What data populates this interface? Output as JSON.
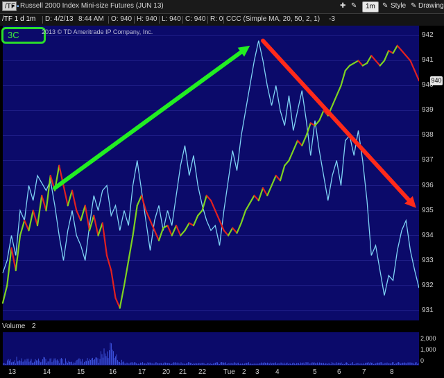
{
  "toolbar": {
    "symbol": "/TF",
    "title": "Russell 2000 Index Mini-size Futures (JUN 13)",
    "timeframe": "1m",
    "style_label": "Style",
    "drawings_label": "Drawings"
  },
  "infobar": {
    "symbol_tf": "/TF 1 d 1m",
    "date": "D: 4/2/13",
    "time": "8:44 AM",
    "open": "O: 940",
    "high": "H: 940",
    "low": "L: 940",
    "close": "C: 940",
    "r": "R: 0",
    "study": "CCC (Simple MA, 20, 50, 2, 1)",
    "study_value": "-3"
  },
  "badge": "3C",
  "copyright": "2013 © TD Ameritrade IP Company, Inc.",
  "volume_label": "Volume",
  "volume_value": "2",
  "last_price": "940",
  "chart_data": {
    "type": "line",
    "x_ticks": [
      "13",
      "14",
      "15",
      "16",
      "17",
      "20",
      "21",
      "22",
      "Tue",
      "2",
      "3",
      "4",
      "5",
      "6",
      "7",
      "8"
    ],
    "y_ticks": [
      942,
      941,
      940,
      939,
      938,
      937,
      936,
      935,
      934,
      933,
      932,
      931
    ],
    "ylim": [
      930.6,
      942.4
    ],
    "volume_ticks": [
      "2,000",
      "1,000",
      "0"
    ],
    "colors": {
      "price_up": "#7ed321",
      "price_down": "#e22020",
      "price_flat": "#f0d000",
      "indicator_3c": "#7fd3f5",
      "arrow_up": "#22ee22",
      "arrow_down": "#ff2a1a"
    },
    "series": [
      {
        "role": "price",
        "points": [
          [
            0,
            931.3
          ],
          [
            3,
            932
          ],
          [
            6,
            933.5
          ],
          [
            9,
            932.6
          ],
          [
            12,
            934
          ],
          [
            15,
            934.6
          ],
          [
            18,
            934.2
          ],
          [
            21,
            935
          ],
          [
            24,
            934.4
          ],
          [
            27,
            935.6
          ],
          [
            30,
            935
          ],
          [
            33,
            936.4
          ],
          [
            36,
            935.8
          ],
          [
            39,
            936.8
          ],
          [
            42,
            936
          ],
          [
            45,
            935.2
          ],
          [
            48,
            935.8
          ],
          [
            51,
            935
          ],
          [
            54,
            934.6
          ],
          [
            57,
            935.2
          ],
          [
            60,
            934.2
          ],
          [
            63,
            934.8
          ],
          [
            66,
            934
          ],
          [
            69,
            934.5
          ],
          [
            72,
            933.2
          ],
          [
            75,
            932.6
          ],
          [
            78,
            931.5
          ],
          [
            81,
            931.1
          ],
          [
            84,
            932
          ],
          [
            87,
            933
          ],
          [
            90,
            934
          ],
          [
            93,
            935.2
          ],
          [
            96,
            935.6
          ],
          [
            99,
            935
          ],
          [
            102,
            934.6
          ],
          [
            105,
            934.2
          ],
          [
            108,
            933.8
          ],
          [
            111,
            934.3
          ],
          [
            114,
            934.4
          ],
          [
            117,
            934
          ],
          [
            120,
            934.4
          ],
          [
            123,
            934
          ],
          [
            126,
            934.2
          ],
          [
            129,
            934.5
          ],
          [
            132,
            934.4
          ],
          [
            135,
            934.8
          ],
          [
            138,
            935
          ],
          [
            141,
            935.6
          ],
          [
            144,
            935.4
          ],
          [
            147,
            935
          ],
          [
            150,
            934.6
          ],
          [
            153,
            934.2
          ],
          [
            156,
            934
          ],
          [
            159,
            934.3
          ],
          [
            162,
            934.1
          ],
          [
            165,
            934.5
          ],
          [
            168,
            935
          ],
          [
            171,
            935.3
          ],
          [
            174,
            935.6
          ],
          [
            177,
            935.4
          ],
          [
            180,
            935.9
          ],
          [
            183,
            935.6
          ],
          [
            186,
            936
          ],
          [
            189,
            936.4
          ],
          [
            192,
            936.2
          ],
          [
            195,
            936.8
          ],
          [
            198,
            937
          ],
          [
            201,
            937.4
          ],
          [
            204,
            937.8
          ],
          [
            207,
            937.6
          ],
          [
            210,
            938
          ],
          [
            213,
            938.5
          ],
          [
            216,
            938.4
          ],
          [
            219,
            938.6
          ],
          [
            222,
            939
          ],
          [
            225,
            938.8
          ],
          [
            228,
            939.2
          ],
          [
            231,
            939.6
          ],
          [
            234,
            940
          ],
          [
            237,
            940.6
          ],
          [
            240,
            940.8
          ],
          [
            243,
            940.9
          ],
          [
            246,
            941
          ],
          [
            249,
            940.8
          ],
          [
            252,
            940.9
          ],
          [
            255,
            941.2
          ],
          [
            258,
            941
          ],
          [
            261,
            940.8
          ],
          [
            264,
            941
          ],
          [
            267,
            941.4
          ],
          [
            270,
            941.3
          ],
          [
            273,
            941.6
          ],
          [
            276,
            941.4
          ],
          [
            279,
            941.2
          ],
          [
            282,
            941
          ],
          [
            285,
            940.6
          ],
          [
            288,
            940.2
          ]
        ]
      },
      {
        "role": "3C",
        "points": [
          [
            0,
            932.5
          ],
          [
            3,
            933
          ],
          [
            6,
            934
          ],
          [
            9,
            933.2
          ],
          [
            12,
            935
          ],
          [
            15,
            934.6
          ],
          [
            18,
            936
          ],
          [
            21,
            935.4
          ],
          [
            24,
            936.4
          ],
          [
            27,
            936.1
          ],
          [
            30,
            935.8
          ],
          [
            33,
            936.2
          ],
          [
            36,
            935.2
          ],
          [
            39,
            934
          ],
          [
            42,
            933
          ],
          [
            45,
            934.2
          ],
          [
            48,
            935
          ],
          [
            51,
            934
          ],
          [
            54,
            933.6
          ],
          [
            57,
            933
          ],
          [
            60,
            934.4
          ],
          [
            63,
            935.6
          ],
          [
            66,
            935
          ],
          [
            69,
            935.8
          ],
          [
            72,
            936
          ],
          [
            75,
            934.8
          ],
          [
            78,
            935.2
          ],
          [
            81,
            934.2
          ],
          [
            84,
            935
          ],
          [
            87,
            934.4
          ],
          [
            90,
            936
          ],
          [
            93,
            937
          ],
          [
            96,
            935.8
          ],
          [
            99,
            934.6
          ],
          [
            102,
            933.4
          ],
          [
            105,
            934.6
          ],
          [
            108,
            935.2
          ],
          [
            111,
            934.2
          ],
          [
            114,
            935
          ],
          [
            117,
            934.4
          ],
          [
            120,
            935.6
          ],
          [
            123,
            936.8
          ],
          [
            126,
            937.6
          ],
          [
            129,
            936.4
          ],
          [
            132,
            937.2
          ],
          [
            135,
            936
          ],
          [
            138,
            935.2
          ],
          [
            141,
            934.6
          ],
          [
            144,
            934.2
          ],
          [
            147,
            934.4
          ],
          [
            150,
            933.6
          ],
          [
            153,
            935
          ],
          [
            156,
            936.2
          ],
          [
            159,
            937.4
          ],
          [
            162,
            936.6
          ],
          [
            165,
            938
          ],
          [
            168,
            939
          ],
          [
            171,
            940
          ],
          [
            174,
            941
          ],
          [
            177,
            941.8
          ],
          [
            180,
            941
          ],
          [
            183,
            940
          ],
          [
            186,
            939.2
          ],
          [
            189,
            940
          ],
          [
            192,
            939
          ],
          [
            195,
            938.4
          ],
          [
            198,
            939.6
          ],
          [
            201,
            938.2
          ],
          [
            204,
            939
          ],
          [
            207,
            939.8
          ],
          [
            210,
            938.6
          ],
          [
            213,
            937.2
          ],
          [
            216,
            938.6
          ],
          [
            219,
            937.4
          ],
          [
            222,
            936.4
          ],
          [
            225,
            935.4
          ],
          [
            228,
            936.4
          ],
          [
            231,
            937
          ],
          [
            234,
            936
          ],
          [
            237,
            937.8
          ],
          [
            240,
            938
          ],
          [
            243,
            937.2
          ],
          [
            246,
            938.2
          ],
          [
            249,
            937
          ],
          [
            252,
            935.4
          ],
          [
            255,
            933.2
          ],
          [
            258,
            933.6
          ],
          [
            261,
            932.6
          ],
          [
            264,
            931.6
          ],
          [
            267,
            932.4
          ],
          [
            270,
            932.2
          ],
          [
            273,
            933.4
          ],
          [
            276,
            934.2
          ],
          [
            279,
            934.6
          ],
          [
            282,
            933.4
          ],
          [
            285,
            932.6
          ],
          [
            288,
            931.9
          ]
        ]
      }
    ],
    "arrows": [
      {
        "color": "arrow_up",
        "from": [
          36,
          935.9
        ],
        "to": [
          171,
          941.6
        ]
      },
      {
        "color": "arrow_down",
        "from": [
          180,
          941.8
        ],
        "to": [
          286,
          935.1
        ]
      }
    ]
  }
}
